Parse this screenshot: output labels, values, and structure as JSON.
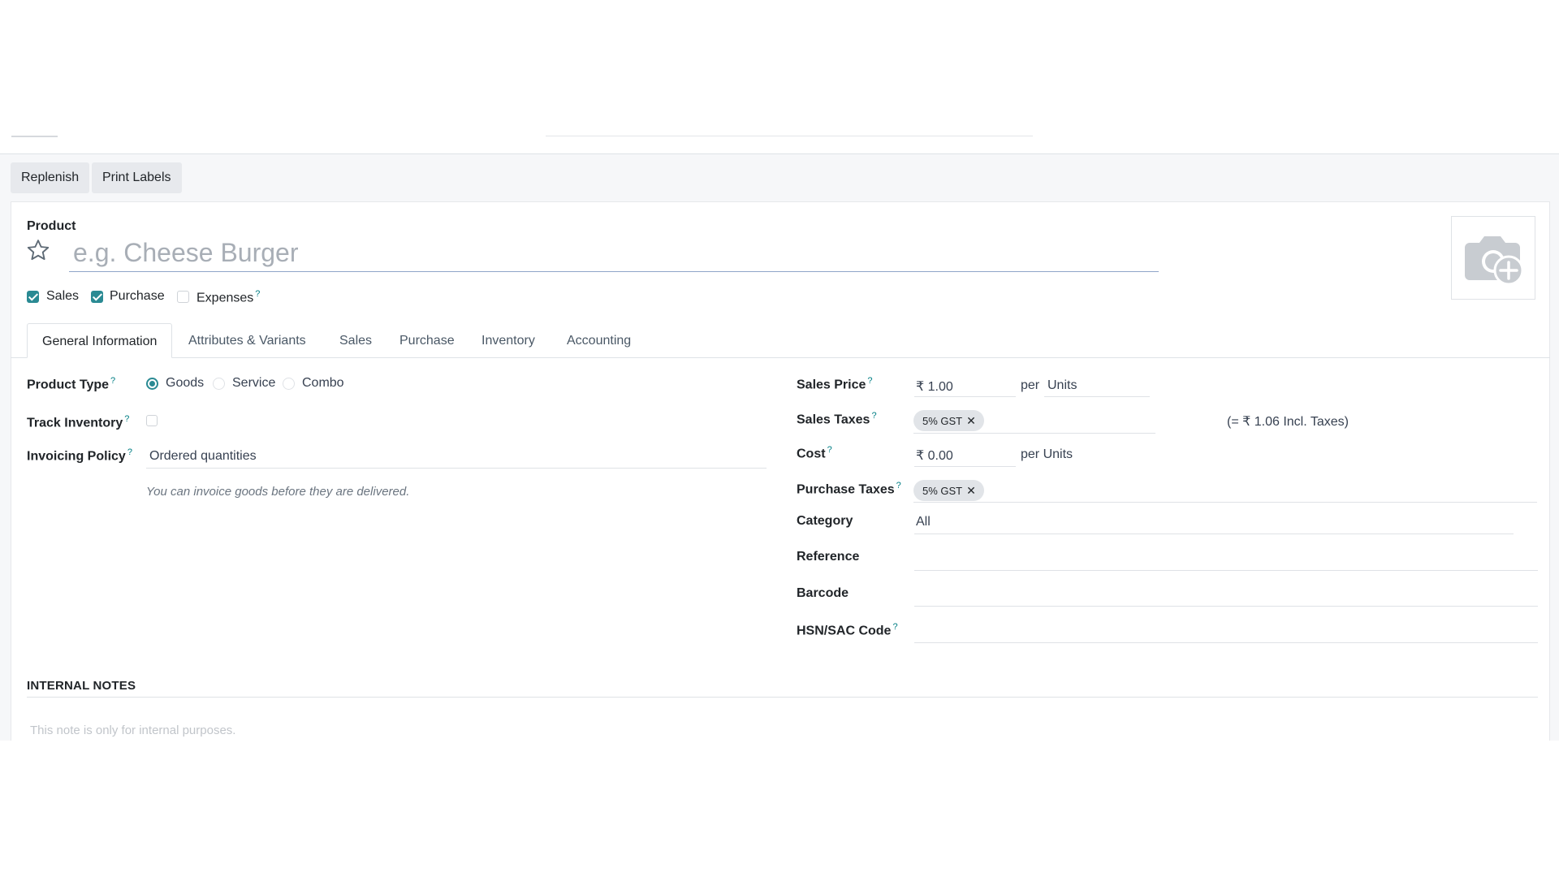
{
  "toolbar": {
    "replenish_label": "Replenish",
    "print_labels_label": "Print Labels"
  },
  "product": {
    "section_label": "Product",
    "name_value": "",
    "name_placeholder": "e.g. Cheese Burger",
    "flags": {
      "sales": {
        "label": "Sales",
        "checked": true
      },
      "purchase": {
        "label": "Purchase",
        "checked": true
      },
      "expenses": {
        "label": "Expenses",
        "checked": false
      }
    }
  },
  "help_mark": "?",
  "tabs": [
    {
      "label": "General Information",
      "active": true
    },
    {
      "label": "Attributes & Variants",
      "active": false
    },
    {
      "label": "Sales",
      "active": false
    },
    {
      "label": "Purchase",
      "active": false
    },
    {
      "label": "Inventory",
      "active": false
    },
    {
      "label": "Accounting",
      "active": false
    }
  ],
  "general": {
    "product_type": {
      "label": "Product Type",
      "options": [
        "Goods",
        "Service",
        "Combo"
      ],
      "selected": "Goods"
    },
    "track_inventory": {
      "label": "Track Inventory",
      "checked": false
    },
    "invoicing_policy": {
      "label": "Invoicing Policy",
      "value": "Ordered quantities",
      "hint": "You can invoice goods before they are delivered."
    }
  },
  "pricing": {
    "sales_price": {
      "label": "Sales Price",
      "value": "₹ 1.00",
      "per": "per",
      "uom": "Units"
    },
    "sales_taxes": {
      "label": "Sales Taxes",
      "tag": "5% GST",
      "incl_note": "(= ₹ 1.06 Incl. Taxes)"
    },
    "cost": {
      "label": "Cost",
      "value": "₹ 0.00",
      "per_uom": "per Units"
    },
    "purchase_taxes": {
      "label": "Purchase Taxes",
      "tag": "5% GST"
    },
    "category": {
      "label": "Category",
      "value": "All"
    },
    "reference": {
      "label": "Reference",
      "value": ""
    },
    "barcode": {
      "label": "Barcode",
      "value": ""
    },
    "hsn": {
      "label": "HSN/SAC Code",
      "value": ""
    }
  },
  "notes": {
    "title": "INTERNAL NOTES",
    "placeholder": "This note is only for internal purposes."
  },
  "colors": {
    "accent": "#2a8a93",
    "help": "#017e84",
    "tag_bg": "#e1e4e8",
    "placeholder": "#a8aeb6"
  },
  "icons": {
    "favorite": "star-outline-icon",
    "image": "camera-plus-icon",
    "remove_tag": "close-icon"
  }
}
